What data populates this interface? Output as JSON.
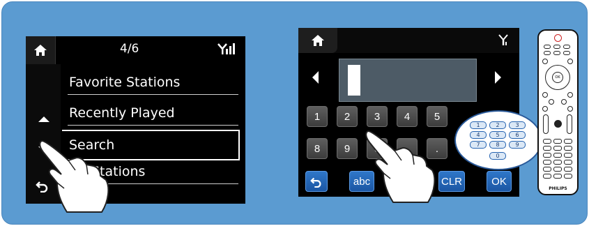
{
  "screen_left": {
    "page_indicator": "4/6",
    "menu_items": [
      {
        "label": "Favorite Stations"
      },
      {
        "label": "Recently Played"
      },
      {
        "label": "Search"
      },
      {
        "label": "Stations"
      }
    ]
  },
  "screen_right": {
    "keys_row1": [
      "1",
      "2",
      "3",
      "4",
      "5"
    ],
    "keys_row2": [
      "8",
      "9",
      "0",
      "",
      "."
    ],
    "bottom_keys": {
      "abc": "abc",
      "clr": "CLR",
      "ok": "OK"
    }
  },
  "keypad_zoom": {
    "keys": [
      "1",
      "2",
      "3",
      "4",
      "5",
      "6",
      "7",
      "8",
      "9",
      "0"
    ]
  },
  "remote": {
    "brand": "PHILIPS"
  },
  "colors": {
    "background": "#5b9bd1",
    "key_blue": "#2f77c9",
    "key_gray": "#4a4a4a"
  },
  "icons": [
    "home-icon",
    "signal-icon",
    "arrow-up-icon",
    "arrow-down-icon",
    "back-icon",
    "arrow-left-icon",
    "arrow-right-icon",
    "pointing-hand"
  ]
}
